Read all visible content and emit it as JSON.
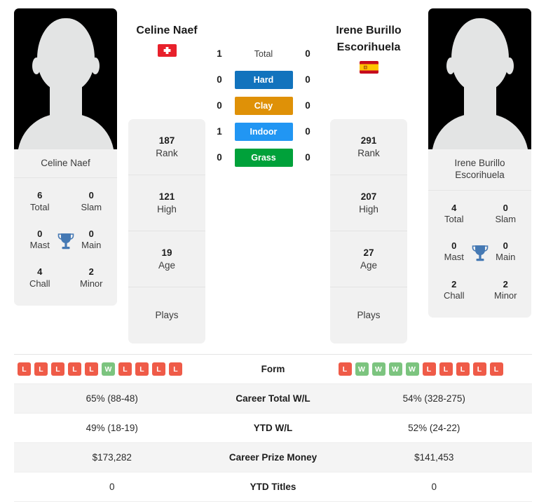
{
  "players": {
    "left": {
      "name": "Celine Naef",
      "flag": "switzerland-flag",
      "flag_alt": "Switzerland",
      "photo_caption": "Celine Naef",
      "titles": [
        {
          "num": "6",
          "label": "Total"
        },
        {
          "num": "0",
          "label": "Slam"
        },
        {
          "num": "0",
          "label": "Mast"
        },
        {
          "num": "0",
          "label": "Main"
        },
        {
          "num": "4",
          "label": "Chall"
        },
        {
          "num": "2",
          "label": "Minor"
        }
      ],
      "stats": [
        {
          "num": "187",
          "label": "Rank"
        },
        {
          "num": "121",
          "label": "High"
        },
        {
          "num": "19",
          "label": "Age"
        },
        {
          "num": "",
          "label": "Plays"
        }
      ]
    },
    "right": {
      "name": "Irene Burillo Escorihuela",
      "flag": "spain-flag",
      "flag_alt": "Spain",
      "photo_caption": "Irene Burillo Escorihuela",
      "titles": [
        {
          "num": "4",
          "label": "Total"
        },
        {
          "num": "0",
          "label": "Slam"
        },
        {
          "num": "0",
          "label": "Mast"
        },
        {
          "num": "0",
          "label": "Main"
        },
        {
          "num": "2",
          "label": "Chall"
        },
        {
          "num": "2",
          "label": "Minor"
        }
      ],
      "stats": [
        {
          "num": "291",
          "label": "Rank"
        },
        {
          "num": "207",
          "label": "High"
        },
        {
          "num": "27",
          "label": "Age"
        },
        {
          "num": "",
          "label": "Plays"
        }
      ]
    }
  },
  "surfaces": [
    {
      "label": "Total",
      "left": "1",
      "right": "0",
      "color": ""
    },
    {
      "label": "Hard",
      "left": "0",
      "right": "0",
      "color": "#1273bd"
    },
    {
      "label": "Clay",
      "left": "0",
      "right": "0",
      "color": "#df9107"
    },
    {
      "label": "Indoor",
      "left": "1",
      "right": "0",
      "color": "#2196f3"
    },
    {
      "label": "Grass",
      "left": "0",
      "right": "0",
      "color": "#00a13a"
    }
  ],
  "comparison": [
    {
      "label": "Form",
      "type": "form",
      "left_form": [
        "L",
        "L",
        "L",
        "L",
        "L",
        "W",
        "L",
        "L",
        "L",
        "L"
      ],
      "right_form": [
        "L",
        "W",
        "W",
        "W",
        "W",
        "L",
        "L",
        "L",
        "L",
        "L"
      ]
    },
    {
      "label": "Career Total W/L",
      "type": "text",
      "left": "65% (88-48)",
      "right": "54% (328-275)"
    },
    {
      "label": "YTD W/L",
      "type": "text",
      "left": "49% (18-19)",
      "right": "52% (24-22)"
    },
    {
      "label": "Career Prize Money",
      "type": "text",
      "left": "$173,282",
      "right": "$141,453"
    },
    {
      "label": "YTD Titles",
      "type": "text",
      "left": "0",
      "right": "0"
    }
  ],
  "colors": {
    "win": "#7cc47f",
    "loss": "#ef5b48",
    "trophy": "#4579b4",
    "card_bg": "#f1f1f1"
  }
}
